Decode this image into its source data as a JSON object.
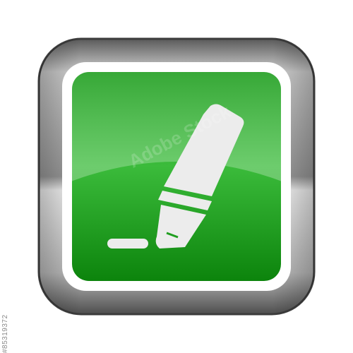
{
  "icon": {
    "name": "highlighter-marker",
    "button_style": "glossy-square"
  },
  "watermark": {
    "brand": "Adobe Stock",
    "id": "#85319372"
  },
  "colors": {
    "frame_light": "#f2f2f2",
    "frame_mid": "#a0a0a0",
    "frame_dark": "#4a4a4a",
    "inner_border": "#ffffff",
    "green_light": "#5fcf5f",
    "green_mid": "#24a824",
    "green_dark": "#0a7a0a",
    "marker_fill": "#ececec"
  }
}
